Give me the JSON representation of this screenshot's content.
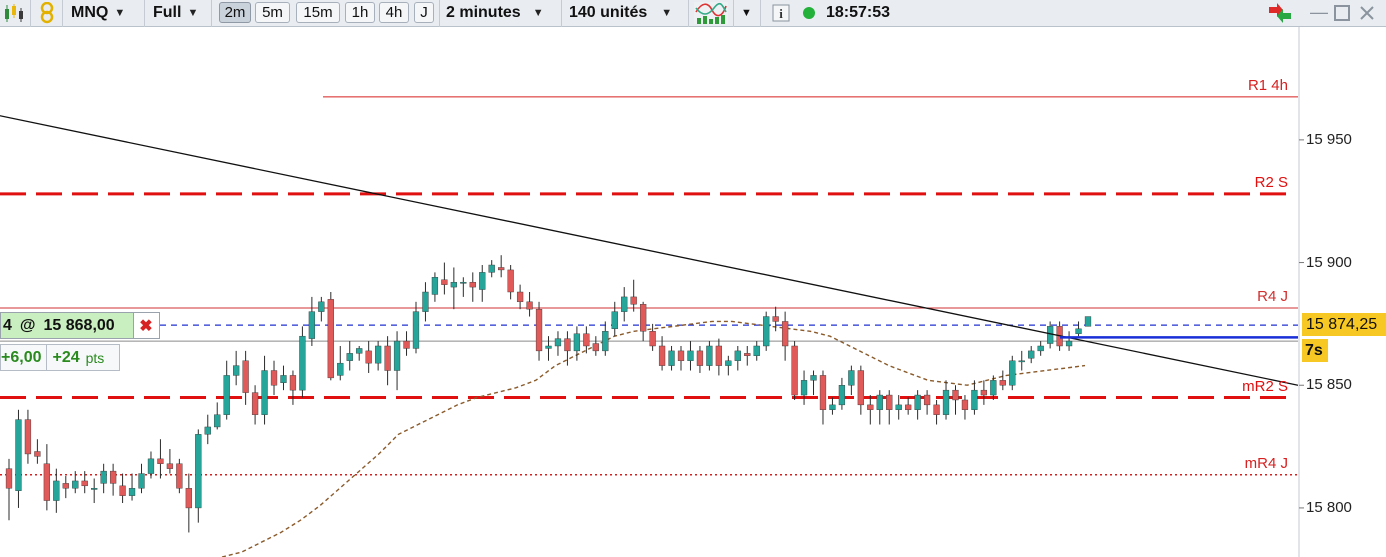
{
  "toolbar": {
    "symbol": "MNQ",
    "view_mode": "Full",
    "timeframes": [
      "2m",
      "5m",
      "15m",
      "1h",
      "4h",
      "J"
    ],
    "active_timeframe": "2m",
    "period": "2 minutes",
    "units": "140 unités",
    "time": "18:57:53"
  },
  "order": {
    "qty_fragment": "4",
    "at": "@",
    "price": "15 868,00",
    "pnl_points": "+6,00",
    "pnl_ticks": "+24",
    "pnl_unit": "pts"
  },
  "price_tag": {
    "value": "15 874,25",
    "timer": "7s"
  },
  "levels": [
    {
      "label": "R1 4h",
      "value": 15967.5,
      "style": "solid",
      "color": "#d81f1f"
    },
    {
      "label": "R2 S",
      "value": 15928.0,
      "style": "dashed",
      "color": "#e01010"
    },
    {
      "label": "R4 J",
      "value": 15881.5,
      "style": "solid",
      "color": "#d03030"
    },
    {
      "label": "mR2 S",
      "value": 15845.0,
      "style": "dashed",
      "color": "#e01010"
    },
    {
      "label": "mR4 J",
      "value": 15813.5,
      "style": "dotted",
      "color": "#d81f1f"
    }
  ],
  "entry_line": {
    "value": 15874.5,
    "color": "#2030d0"
  },
  "current_price": 15874.25,
  "axis_ticks": [
    {
      "label": "15 950",
      "value": 15950
    },
    {
      "label": "15 900",
      "value": 15900
    },
    {
      "label": "15 850",
      "value": 15850
    },
    {
      "label": "15 800",
      "value": 15800
    }
  ],
  "chart_data": {
    "type": "candlestick",
    "y_range": [
      15780,
      15996
    ],
    "colors": {
      "up": "#26a69a",
      "down": "#e05a5a"
    },
    "candles": [
      [
        15816,
        15808,
        15820,
        15795
      ],
      [
        15807,
        15836,
        15840,
        15800
      ],
      [
        15836,
        15822,
        15840,
        15818
      ],
      [
        15823,
        15821,
        15828,
        15818
      ],
      [
        15818,
        15803,
        15826,
        15799
      ],
      [
        15803,
        15811,
        15816,
        15798
      ],
      [
        15810,
        15808,
        15813,
        15804
      ],
      [
        15808,
        15811,
        15815,
        15806
      ],
      [
        15811,
        15809,
        15815,
        15806
      ],
      [
        15808,
        15808,
        15812,
        15802
      ],
      [
        15810,
        15815,
        15818,
        15806
      ],
      [
        15815,
        15810,
        15818,
        15805
      ],
      [
        15809,
        15805,
        15814,
        15802
      ],
      [
        15805,
        15808,
        15814,
        15803
      ],
      [
        15808,
        15814,
        15818,
        15806
      ],
      [
        15814,
        15820,
        15823,
        15812
      ],
      [
        15820,
        15818,
        15828,
        15812
      ],
      [
        15818,
        15816,
        15824,
        15814
      ],
      [
        15818,
        15808,
        15820,
        15806
      ],
      [
        15808,
        15800,
        15814,
        15790
      ],
      [
        15800,
        15830,
        15832,
        15794
      ],
      [
        15830,
        15833,
        15838,
        15826
      ],
      [
        15833,
        15838,
        15843,
        15832
      ],
      [
        15838,
        15854,
        15860,
        15836
      ],
      [
        15854,
        15858,
        15864,
        15850
      ],
      [
        15860,
        15847,
        15864,
        15842
      ],
      [
        15847,
        15838,
        15850,
        15834
      ],
      [
        15838,
        15856,
        15862,
        15834
      ],
      [
        15856,
        15850,
        15860,
        15846
      ],
      [
        15851,
        15854,
        15858,
        15848
      ],
      [
        15854,
        15848,
        15856,
        15842
      ],
      [
        15848,
        15870,
        15874,
        15845
      ],
      [
        15869,
        15880,
        15886,
        15866
      ],
      [
        15880,
        15884,
        15886,
        15876
      ],
      [
        15885,
        15853,
        15888,
        15852
      ],
      [
        15854,
        15859,
        15866,
        15852
      ],
      [
        15860,
        15863,
        15868,
        15856
      ],
      [
        15863,
        15865,
        15866,
        15860
      ],
      [
        15864,
        15859,
        15868,
        15855
      ],
      [
        15859,
        15866,
        15868,
        15856
      ],
      [
        15866,
        15856,
        15870,
        15850
      ],
      [
        15856,
        15868,
        15872,
        15848
      ],
      [
        15868,
        15865,
        15872,
        15862
      ],
      [
        15865,
        15880,
        15884,
        15863
      ],
      [
        15880,
        15888,
        15892,
        15876
      ],
      [
        15887,
        15894,
        15896,
        15884
      ],
      [
        15893,
        15891,
        15900,
        15887
      ],
      [
        15890,
        15892,
        15898,
        15881
      ],
      [
        15892,
        15892,
        15894,
        15886
      ],
      [
        15892,
        15890,
        15896,
        15884
      ],
      [
        15889,
        15896,
        15899,
        15884
      ],
      [
        15896,
        15899,
        15901,
        15894
      ],
      [
        15898,
        15897,
        15903,
        15894
      ],
      [
        15897,
        15888,
        15899,
        15885
      ],
      [
        15888,
        15884,
        15891,
        15881
      ],
      [
        15884,
        15881,
        15888,
        15878
      ],
      [
        15881,
        15864,
        15884,
        15860
      ],
      [
        15865,
        15866,
        15870,
        15860
      ],
      [
        15866,
        15869,
        15872,
        15862
      ],
      [
        15869,
        15864,
        15872,
        15858
      ],
      [
        15864,
        15871,
        15874,
        15860
      ],
      [
        15871,
        15866,
        15874,
        15863
      ],
      [
        15867,
        15864,
        15870,
        15862
      ],
      [
        15864,
        15872,
        15876,
        15862
      ],
      [
        15873,
        15880,
        15884,
        15870
      ],
      [
        15880,
        15886,
        15890,
        15876
      ],
      [
        15886,
        15883,
        15893,
        15880
      ],
      [
        15883,
        15872,
        15884,
        15868
      ],
      [
        15872,
        15866,
        15875,
        15864
      ],
      [
        15866,
        15858,
        15870,
        15856
      ],
      [
        15858,
        15864,
        15866,
        15856
      ],
      [
        15864,
        15860,
        15866,
        15856
      ],
      [
        15860,
        15864,
        15868,
        15856
      ],
      [
        15864,
        15858,
        15866,
        15855
      ],
      [
        15858,
        15866,
        15868,
        15856
      ],
      [
        15866,
        15858,
        15869,
        15854
      ],
      [
        15858,
        15860,
        15862,
        15854
      ],
      [
        15860,
        15864,
        15866,
        15856
      ],
      [
        15863,
        15862,
        15866,
        15858
      ],
      [
        15862,
        15866,
        15868,
        15860
      ],
      [
        15866,
        15878,
        15880,
        15864
      ],
      [
        15878,
        15876,
        15882,
        15872
      ],
      [
        15876,
        15866,
        15880,
        15860
      ],
      [
        15866,
        15846,
        15868,
        15844
      ],
      [
        15846,
        15852,
        15856,
        15842
      ],
      [
        15852,
        15854,
        15856,
        15846
      ],
      [
        15854,
        15840,
        15856,
        15834
      ],
      [
        15840,
        15842,
        15845,
        15838
      ],
      [
        15842,
        15850,
        15853,
        15840
      ],
      [
        15850,
        15856,
        15858,
        15846
      ],
      [
        15856,
        15842,
        15858,
        15838
      ],
      [
        15842,
        15840,
        15846,
        15834
      ],
      [
        15840,
        15846,
        15848,
        15834
      ],
      [
        15846,
        15840,
        15848,
        15834
      ],
      [
        15840,
        15842,
        15846,
        15836
      ],
      [
        15842,
        15840,
        15845,
        15838
      ],
      [
        15840,
        15846,
        15848,
        15836
      ],
      [
        15846,
        15842,
        15848,
        15838
      ],
      [
        15842,
        15838,
        15844,
        15834
      ],
      [
        15838,
        15848,
        15852,
        15836
      ],
      [
        15848,
        15844,
        15850,
        15838
      ],
      [
        15844,
        15840,
        15846,
        15836
      ],
      [
        15840,
        15848,
        15852,
        15838
      ],
      [
        15848,
        15846,
        15852,
        15842
      ],
      [
        15846,
        15852,
        15854,
        15844
      ],
      [
        15852,
        15850,
        15856,
        15848
      ],
      [
        15850,
        15860,
        15862,
        15848
      ],
      [
        15860,
        15860,
        15864,
        15856
      ],
      [
        15861,
        15864,
        15866,
        15859
      ],
      [
        15864,
        15866,
        15868,
        15862
      ],
      [
        15867,
        15874,
        15876,
        15865
      ],
      [
        15874,
        15866,
        15876,
        15864
      ],
      [
        15866,
        15868,
        15872,
        15864
      ],
      [
        15871,
        15873,
        15876,
        15870
      ],
      [
        15874,
        15878,
        15878,
        15874
      ]
    ],
    "moving_average": [
      [
        15780,
        15782,
        15786,
        15790,
        15795,
        15801,
        15808,
        15815,
        15822,
        15830,
        15834,
        15838,
        15842,
        15845,
        15847,
        15849,
        15852,
        15858,
        15862,
        15866,
        15870,
        15872,
        15873,
        15874,
        15875,
        15876,
        15876,
        15875,
        15874,
        15873,
        15872,
        15870,
        15866,
        15862,
        15858,
        15855,
        15852,
        15851,
        15850,
        15852,
        15854,
        15855,
        15856,
        15857,
        15858
      ]
    ],
    "trendline": [
      [
        -2,
        15960
      ],
      [
        1300,
        15850
      ]
    ],
    "current_ray": [
      1060,
      15869.5
    ]
  }
}
